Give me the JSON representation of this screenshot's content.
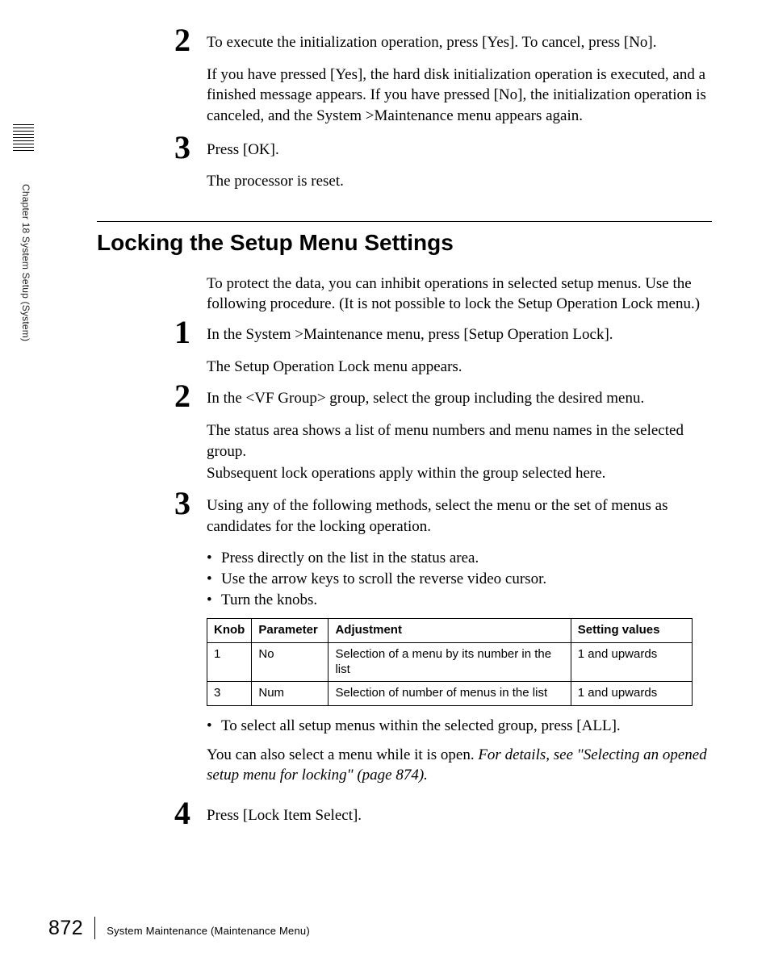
{
  "sidebar_label": "Chapter 18  System Setup (System)",
  "steps_top": [
    {
      "num": "2",
      "lines": [
        "To execute the initialization operation, press [Yes]. To cancel, press [No].",
        "If you have pressed [Yes], the hard disk initialization operation is executed, and a finished message appears. If you have pressed [No], the initialization operation is canceled, and the System >Maintenance menu appears again."
      ]
    },
    {
      "num": "3",
      "lines": [
        "Press [OK].",
        "The processor is reset."
      ]
    }
  ],
  "section_heading": "Locking the Setup Menu Settings",
  "section_intro": "To protect the data, you can inhibit operations in selected setup menus. Use the following procedure. (It is not possible to lock the Setup Operation Lock menu.)",
  "steps_main": [
    {
      "num": "1",
      "lead": "In the System >Maintenance menu, press [Setup Operation Lock].",
      "after": "The Setup Operation Lock menu appears."
    },
    {
      "num": "2",
      "lead": "In the <VF Group> group, select the group including the desired menu.",
      "after": "The status area shows a list of menu numbers and menu names in the selected group.",
      "after2": "Subsequent lock operations apply within the group selected here."
    },
    {
      "num": "3",
      "lead": "Using any of the following methods, select the menu or the set of menus as candidates for the locking operation.",
      "bullets": [
        "Press directly on the list in the status area.",
        "Use the arrow keys to scroll the reverse video cursor.",
        "Turn the knobs."
      ],
      "table": {
        "headers": [
          "Knob",
          "Parameter",
          "Adjustment",
          "Setting values"
        ],
        "rows": [
          [
            "1",
            "No",
            "Selection of a menu by its number in the  list",
            "1 and upwards"
          ],
          [
            "3",
            "Num",
            "Selection of number of menus in the list",
            "1 and upwards"
          ]
        ]
      },
      "after_bullet": "To select all setup menus within the selected group, press [ALL].",
      "after_text_plain": "You can also select a menu while it is open. ",
      "after_text_italic": "For details, see \"Selecting an opened setup menu for locking\" (page 874)."
    },
    {
      "num": "4",
      "lead": "Press [Lock Item Select]."
    }
  ],
  "footer": {
    "page": "872",
    "text": "System Maintenance (Maintenance Menu)"
  }
}
